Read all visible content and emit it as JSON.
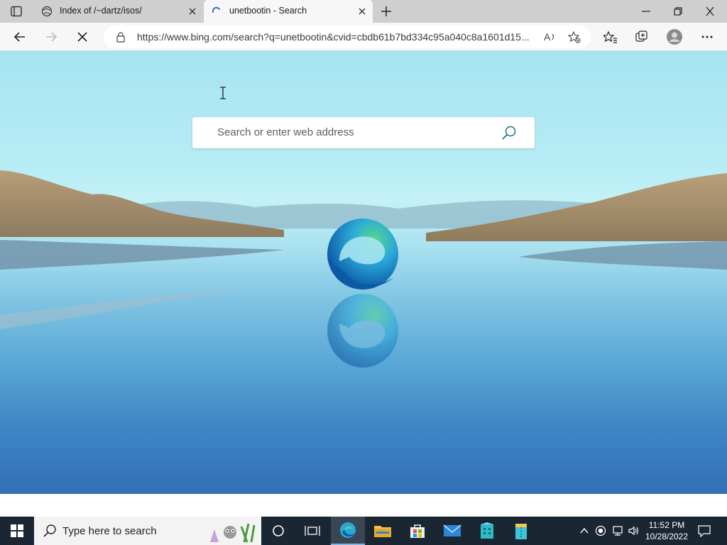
{
  "tabs": [
    {
      "title": "Index of /~dartz/isos/",
      "active": false
    },
    {
      "title": "unetbootin - Search",
      "active": true
    }
  ],
  "address": {
    "url": "https://www.bing.com/search?q=unetbootin&cvid=cbdb61b7bd334c95a040c8a1601d15..."
  },
  "newtab": {
    "search_placeholder": "Search or enter web address"
  },
  "taskbar": {
    "search_placeholder": "Type here to search",
    "time": "11:52 PM",
    "date": "10/28/2022"
  },
  "colors": {
    "tabstrip": "#cfcfcf",
    "toolbar": "#f7f7f7",
    "taskbar": "#1b2633",
    "edge_blue": "#0c59a4",
    "edge_green": "#4ed27e"
  }
}
